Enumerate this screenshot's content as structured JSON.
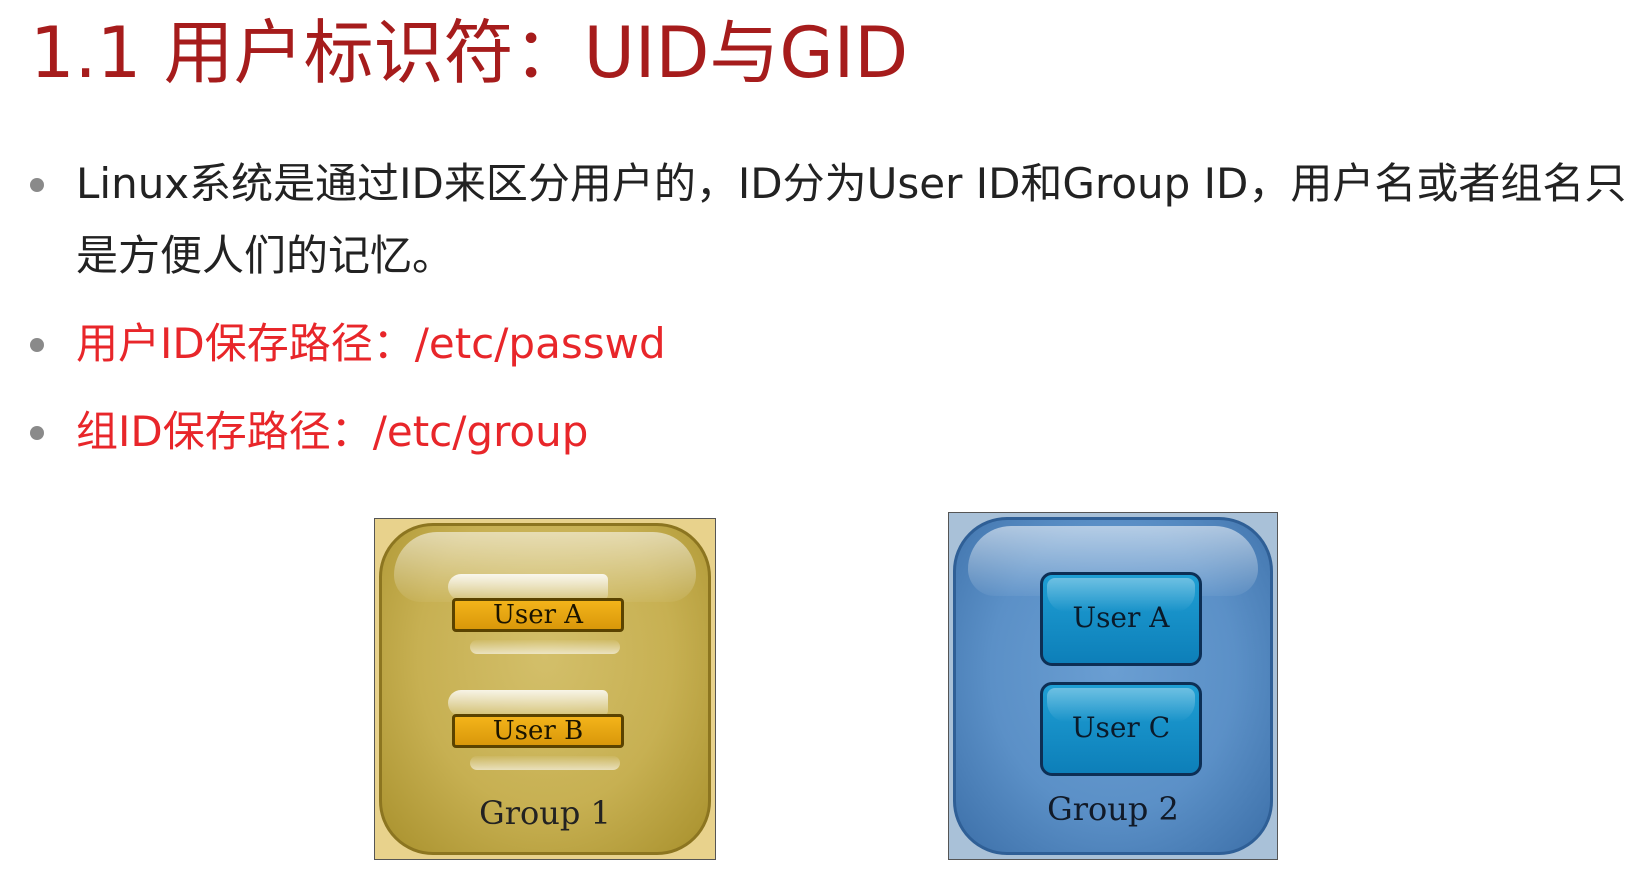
{
  "slide": {
    "title": "1.1 用户标识符：UID与GID",
    "bullets": [
      "Linux系统是通过ID来区分用户的，ID分为User ID和Group ID，用户名或者组名只是方便人们的记忆。",
      "用户ID保存路径：/etc/passwd",
      "组ID保存路径：/etc/group"
    ]
  },
  "diagram": {
    "group1": {
      "label": "Group 1",
      "color": "#c7b052",
      "users": [
        "User A",
        "User B"
      ]
    },
    "group2": {
      "label": "Group 2",
      "color": "#5b90c7",
      "users": [
        "User A",
        "User C"
      ]
    }
  },
  "colors": {
    "title": "#a61c1c",
    "highlight": "#e8262a",
    "text": "#222222"
  }
}
